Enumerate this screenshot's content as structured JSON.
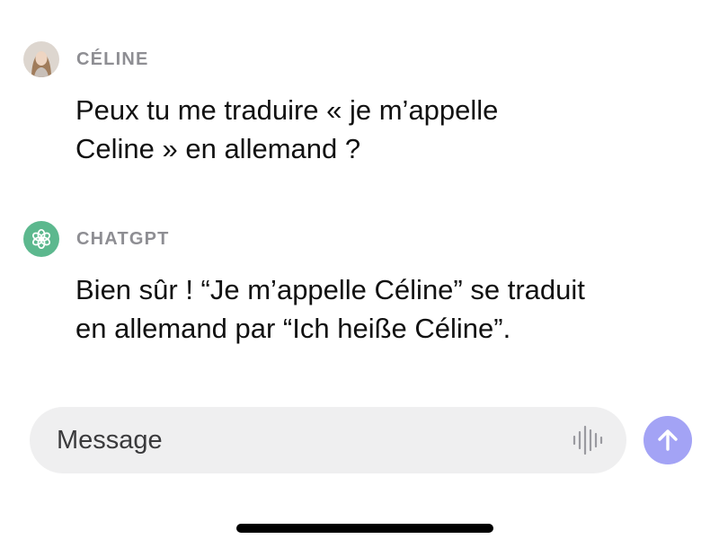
{
  "conversation": {
    "messages": [
      {
        "sender": "CÉLINE",
        "avatar_icon": "user-photo-avatar",
        "lines": [
          "Peux tu me traduire « je m’appelle",
          "Celine » en allemand ?"
        ]
      },
      {
        "sender": "CHATGPT",
        "avatar_icon": "openai-logo-icon",
        "avatar_color": "#5cb88e",
        "lines": [
          "Bien sûr ! “Je m’appelle Céline” se traduit",
          "en allemand par “Ich heiße Céline”."
        ]
      }
    ]
  },
  "composer": {
    "placeholder": "Message",
    "voice_icon": "voice-waveform-icon",
    "send_icon": "arrow-up-icon",
    "send_color": "#a3a3f5"
  }
}
